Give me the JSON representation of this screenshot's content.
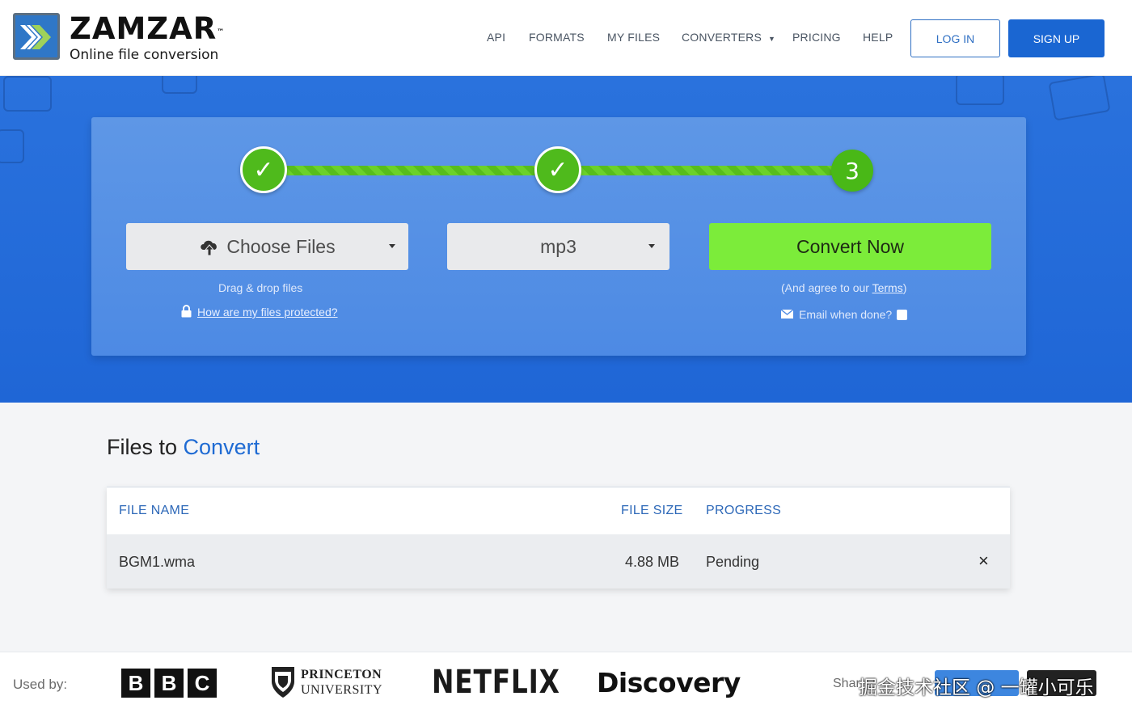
{
  "brand": {
    "name": "ZAMZAR",
    "trademark": "™",
    "tagline": "Online file conversion"
  },
  "nav": {
    "items": [
      "API",
      "FORMATS",
      "MY FILES",
      "CONVERTERS",
      "PRICING",
      "HELP"
    ],
    "login": "LOG IN",
    "signup": "SIGN UP"
  },
  "steps": {
    "step1": "✓",
    "step2": "✓",
    "step3": "3"
  },
  "converter": {
    "choose_files": "Choose Files",
    "drag_drop": "Drag & drop files",
    "protected_link": "How are my files protected?",
    "format": "mp3",
    "convert_button": "Convert Now",
    "terms_prefix": "(And agree to our ",
    "terms_link": "Terms",
    "terms_suffix": ")",
    "email_label": "Email when done?"
  },
  "files": {
    "title_part1": "Files to",
    "title_part2": "Convert",
    "columns": [
      "FILE NAME",
      "FILE SIZE",
      "PROGRESS"
    ],
    "rows": [
      {
        "name": "BGM1.wma",
        "size": "4.88 MB",
        "progress": "Pending",
        "remove": "×"
      }
    ]
  },
  "footer": {
    "used_by": "Used by:",
    "logos": {
      "bbc": [
        "B",
        "B",
        "C"
      ],
      "princeton_1": "PRINCETON",
      "princeton_2": "UNIVERSITY",
      "netflix": "NETFLIX",
      "discovery": "Discovery"
    },
    "share": "Shar",
    "watermark": "掘金技术社区 @ 一罐小可乐"
  },
  "colors": {
    "brand_blue": "#1a66d2",
    "hero_blue": "#2a72dd",
    "step_green": "#4fba1c",
    "convert_green": "#7cec3a",
    "table_header_text": "#2d68b8"
  },
  "icons": [
    "zamzar-logo-icon",
    "cloud-upload-icon",
    "lock-icon",
    "envelope-icon",
    "checkmark-icon",
    "close-icon",
    "princeton-shield-icon"
  ]
}
